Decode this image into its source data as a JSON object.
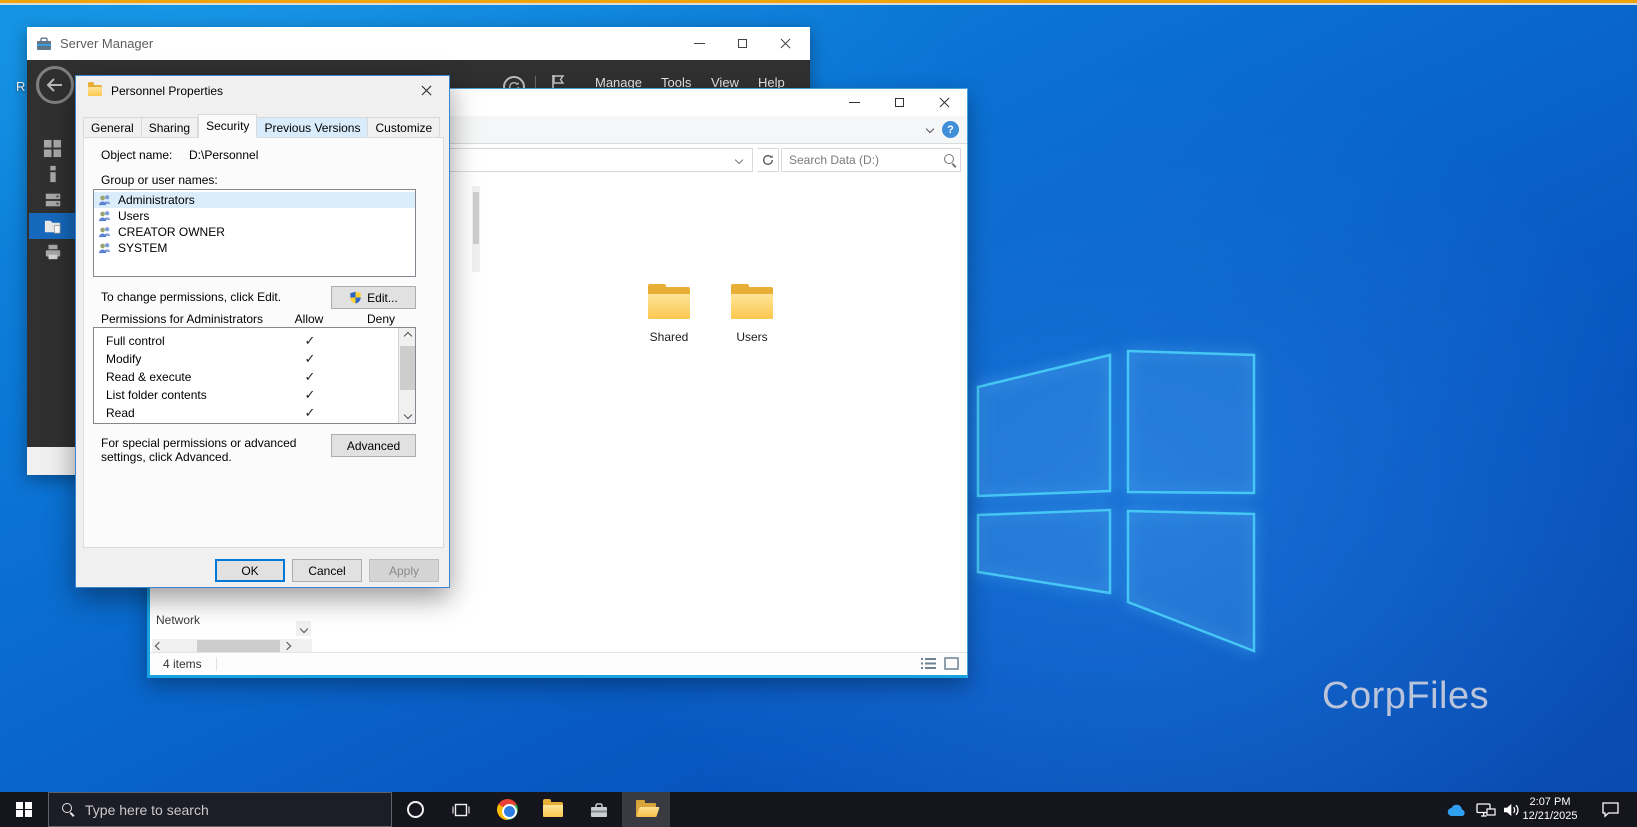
{
  "desktop": {
    "watermark": "CorpFiles",
    "icon_label_fragment": "R"
  },
  "server_manager": {
    "title": "Server Manager",
    "menu_items": [
      "Manage",
      "Tools",
      "View",
      "Help"
    ]
  },
  "explorer": {
    "search_placeholder": "Search Data (D:)",
    "items": [
      {
        "label": "Shared"
      },
      {
        "label": "Users"
      }
    ],
    "nav_bottom_item": "Network",
    "status_text": "4 items"
  },
  "dialog": {
    "title": "Personnel Properties",
    "tabs": [
      "General",
      "Sharing",
      "Security",
      "Previous Versions",
      "Customize"
    ],
    "object_name_label": "Object name:",
    "object_name_value": "D:\\Personnel",
    "group_list_label": "Group or user names:",
    "groups": [
      "Administrators",
      "Users",
      "CREATOR OWNER",
      "SYSTEM"
    ],
    "edit_hint": "To change permissions, click Edit.",
    "edit_button_label": "Edit...",
    "permissions_label": "Permissions for Administrators",
    "allow_header": "Allow",
    "deny_header": "Deny",
    "permissions": [
      {
        "name": "Full control",
        "allow": "✓",
        "deny": ""
      },
      {
        "name": "Modify",
        "allow": "✓",
        "deny": ""
      },
      {
        "name": "Read & execute",
        "allow": "✓",
        "deny": ""
      },
      {
        "name": "List folder contents",
        "allow": "✓",
        "deny": ""
      },
      {
        "name": "Read",
        "allow": "✓",
        "deny": ""
      }
    ],
    "advanced_hint_line1": "For special permissions or advanced",
    "advanced_hint_line2": "settings, click Advanced.",
    "advanced_button_label": "Advanced",
    "ok_label": "OK",
    "cancel_label": "Cancel",
    "apply_label": "Apply"
  },
  "taskbar": {
    "search_placeholder": "Type here to search",
    "time": "2:07 PM",
    "date": "12/21/2025"
  }
}
